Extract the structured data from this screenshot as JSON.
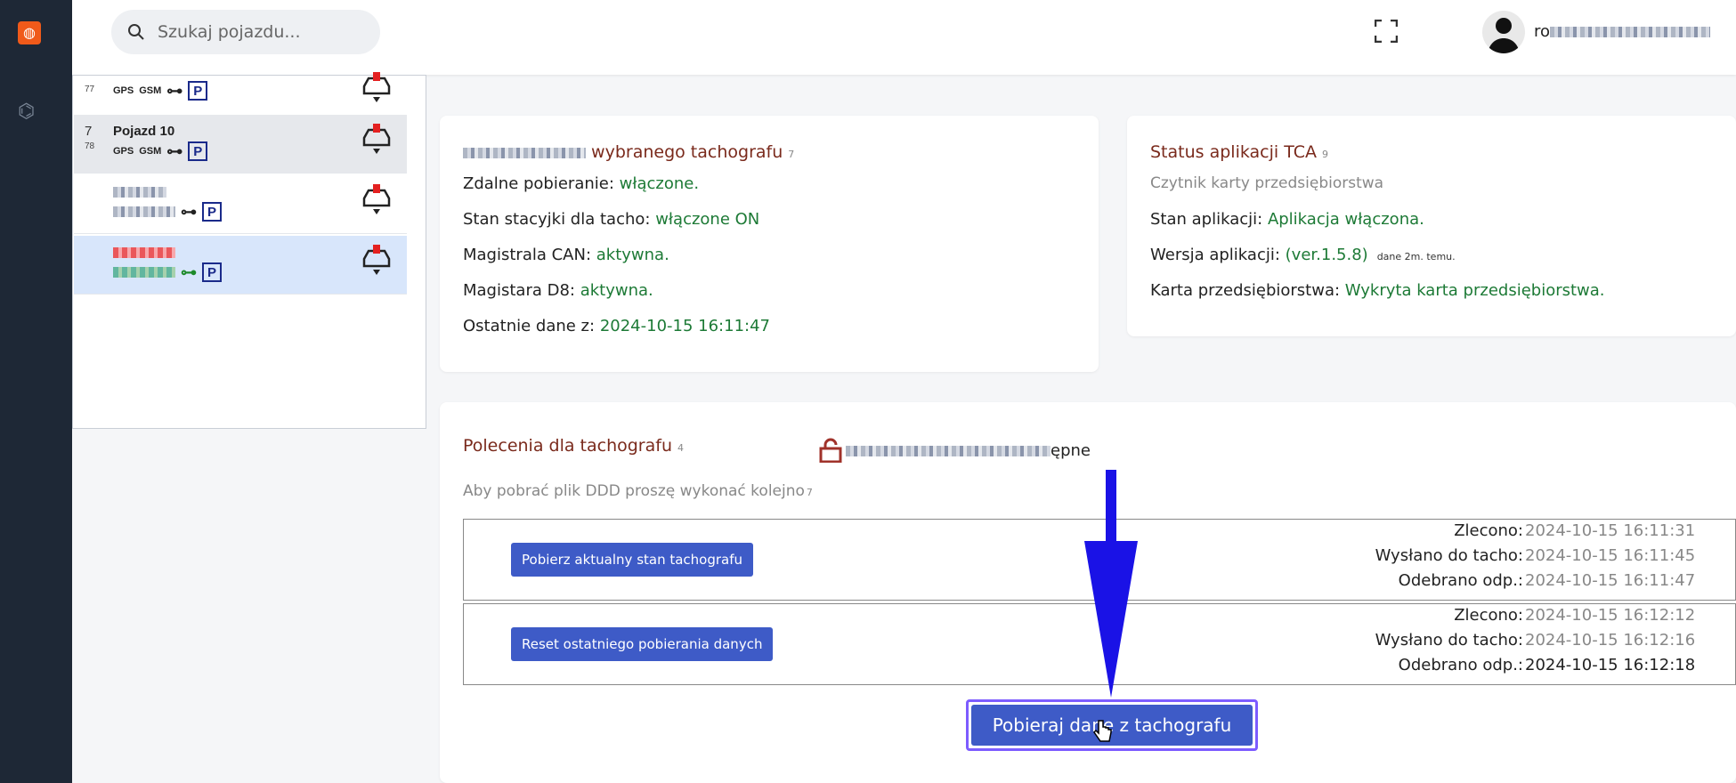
{
  "search": {
    "placeholder": "Szukaj pojazdu..."
  },
  "user": {
    "name": "ro"
  },
  "vehicles": [
    {
      "num1": "",
      "num2": "77",
      "name": "",
      "tags": [
        "GPS",
        "GSM"
      ],
      "selected": false
    },
    {
      "num1": "7",
      "num2": "78",
      "name": "Pojazd 10",
      "tags": [
        "GPS",
        "GSM"
      ],
      "selected": false
    },
    {
      "num1": "",
      "num2": "",
      "name": "",
      "tags": [],
      "selected": false
    },
    {
      "num1": "",
      "num2": "",
      "name": "",
      "tags": [],
      "selected": true
    }
  ],
  "tacho_card": {
    "title_suffix": "wybranego tachografu",
    "title_sup": "7",
    "lines": [
      {
        "label": "Zdalne pobieranie:",
        "value": "włączone."
      },
      {
        "label": "Stan stacyjki dla tacho:",
        "value": "włączone ON"
      },
      {
        "label": "Magistrala CAN:",
        "value": "aktywna."
      },
      {
        "label": "Magistara D8:",
        "value": "aktywna."
      },
      {
        "label": "Ostatnie dane z:",
        "value": "2024-10-15 16:11:47"
      }
    ]
  },
  "tca_card": {
    "title": "Status aplikacji TCA",
    "title_sup": "9",
    "subtitle": "Czytnik karty przedsiębiorstwa",
    "lines": [
      {
        "label": "Stan aplikacji:",
        "value": "Aplikacja włączona."
      },
      {
        "label": "Wersja aplikacji:",
        "value": "(ver.1.5.8)",
        "note": "dane 2m. temu."
      },
      {
        "label": "Karta przedsiębiorstwa:",
        "value": "Wykryta karta przedsiębiorstwa."
      }
    ]
  },
  "commands": {
    "title": "Polecenia dla tachografu",
    "title_sup": "4",
    "status_tail": "ępne",
    "instruction": "Aby pobrać plik DDD proszę wykonać kolejno",
    "instruction_sup": "7",
    "rows": [
      {
        "button": "Pobierz aktualny stan tachografu",
        "times": [
          {
            "label": "Zlecono:",
            "value": "2024-10-15 16:11:31",
            "muted": true
          },
          {
            "label": "Wysłano do tacho:",
            "value": "2024-10-15 16:11:45",
            "muted": true
          },
          {
            "label": "Odebrano odp.:",
            "value": "2024-10-15 16:11:47",
            "muted": true
          }
        ]
      },
      {
        "button": "Reset ostatniego pobierania danych",
        "times": [
          {
            "label": "Zlecono:",
            "value": "2024-10-15 16:12:12",
            "muted": true
          },
          {
            "label": "Wysłano do tacho:",
            "value": "2024-10-15 16:12:16",
            "muted": true
          },
          {
            "label": "Odebrano odp.:",
            "value": "2024-10-15 16:12:18",
            "muted": false
          }
        ]
      }
    ],
    "main_button": "Pobieraj dane z tachografu"
  },
  "colors": {
    "sidebar": "#1e2836",
    "accent": "#3e5bc7",
    "title": "#7a2a1c",
    "ok": "#1d7a36",
    "arrow": "#1a12e6"
  }
}
